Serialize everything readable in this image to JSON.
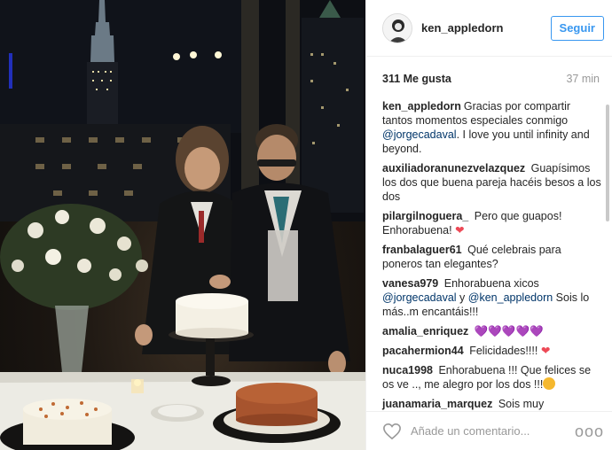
{
  "post": {
    "username": "ken_appledorn",
    "follow_label": "Seguir",
    "likes": "311 Me gusta",
    "time": "37 min",
    "comment_placeholder": "Añade un comentario...",
    "more_label": "ooo"
  },
  "caption": {
    "author": "ken_appledorn",
    "text_1": "Gracias por compartir tantos momentos especiales conmigo ",
    "mention": "@jorgecadaval",
    "text_2": ". I love you until infinity and beyond."
  },
  "comments": [
    {
      "author": "auxiliadoranunezvelazquez",
      "text": "Guapísimos los dos que buena pareja hacéis besos a los dos"
    },
    {
      "author": "pilargilnoguera_",
      "text": "Pero que guapos! Enhorabuena!",
      "emoji": "❤"
    },
    {
      "author": "franbalaguer61",
      "text": "Qué celebrais para poneros tan elegantes?"
    },
    {
      "author": "vanesa979",
      "text_1": "Enhorabuena xicos ",
      "mention_1": "@jorgecadaval",
      "text_2": " y ",
      "mention_2": "@ken_appledorn",
      "text_3": " Sois lo más..m encantáis!!!"
    },
    {
      "author": "amalia_enriquez",
      "emoji": "💜💜💜💜💜"
    },
    {
      "author": "pacahermion44",
      "text": "Felicidades!!!!",
      "emoji": "❤"
    },
    {
      "author": "nuca1998",
      "text": "Enhorabuena !!! Que felices se os ve .., me alegro por los dos !!!"
    },
    {
      "author": "juanamaria_marquez",
      "text": "Sois muy"
    }
  ],
  "colors": {
    "accent": "#3897f0",
    "mention": "#003569",
    "heart": "#ed4956",
    "muted": "#999999"
  },
  "icons": {
    "like": "heart-outline-icon",
    "more": "more-options-icon"
  }
}
